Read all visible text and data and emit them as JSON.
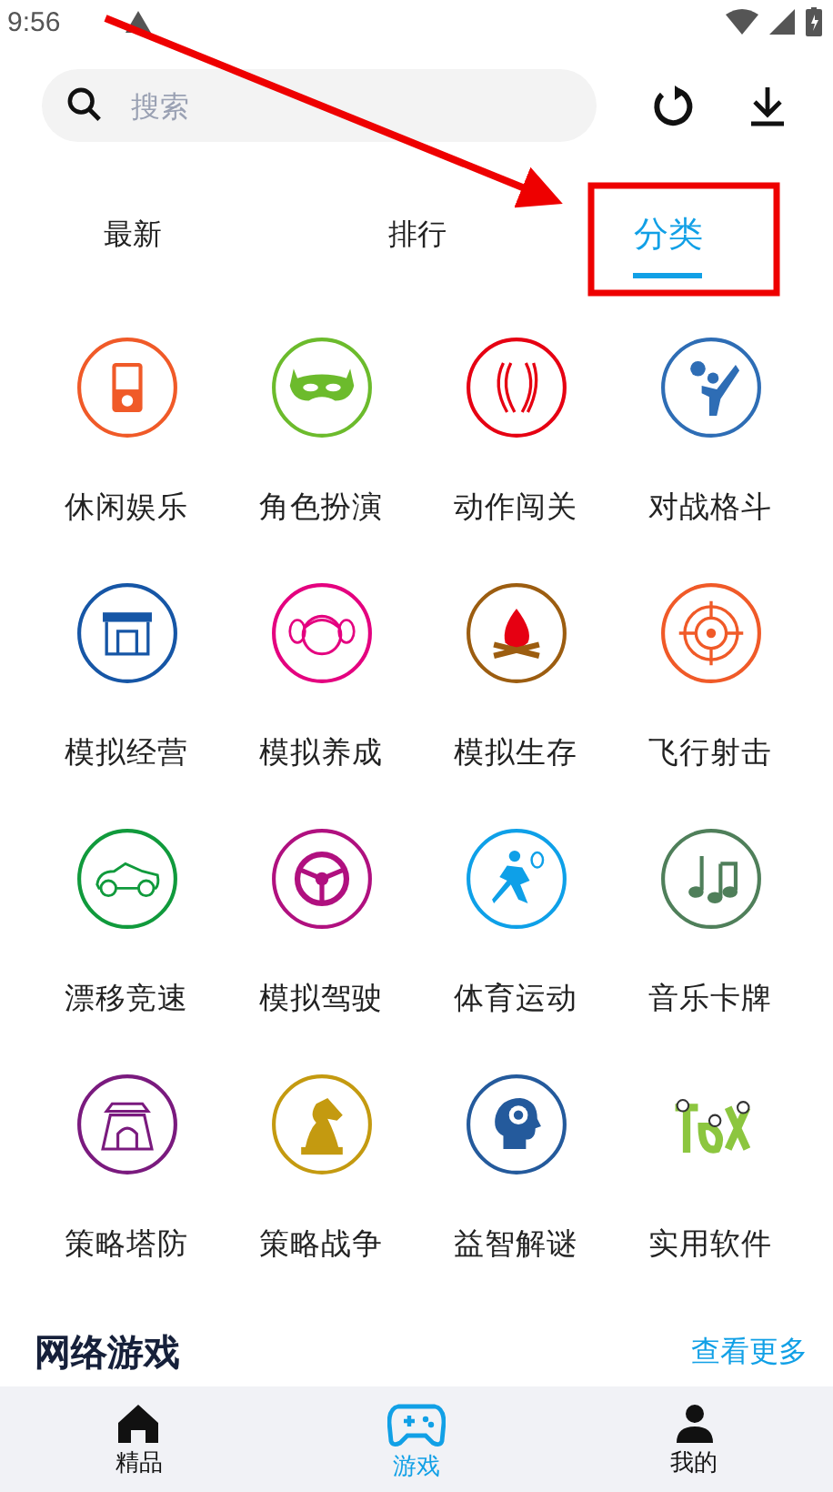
{
  "status_bar": {
    "time": "9:56"
  },
  "search": {
    "placeholder": "搜索"
  },
  "tabs": [
    {
      "label": "最新",
      "selected": false
    },
    {
      "label": "排行",
      "selected": false
    },
    {
      "label": "分类",
      "selected": true
    }
  ],
  "categories": [
    {
      "label": "休闲娱乐",
      "color": "#f05a28"
    },
    {
      "label": "角色扮演",
      "color": "#6cbb2c"
    },
    {
      "label": "动作闯关",
      "color": "#e60012"
    },
    {
      "label": "对战格斗",
      "color": "#2e6db5"
    },
    {
      "label": "模拟经营",
      "color": "#1656a6"
    },
    {
      "label": "模拟养成",
      "color": "#e4007f"
    },
    {
      "label": "模拟生存",
      "color": "#9c5d10"
    },
    {
      "label": "飞行射击",
      "color": "#f05a28"
    },
    {
      "label": "漂移竞速",
      "color": "#109a3c"
    },
    {
      "label": "模拟驾驶",
      "color": "#b0107f"
    },
    {
      "label": "体育运动",
      "color": "#0ea0e8"
    },
    {
      "label": "音乐卡牌",
      "color": "#4f7f5a"
    },
    {
      "label": "策略塔防",
      "color": "#7a1a7e"
    },
    {
      "label": "策略战争",
      "color": "#c49a10"
    },
    {
      "label": "益智解谜",
      "color": "#245a9c"
    },
    {
      "label": "实用软件",
      "color": "#8cc63f"
    }
  ],
  "section": {
    "title": "网络游戏",
    "more": "查看更多"
  },
  "bottom_nav": [
    {
      "label": "精品",
      "selected": false
    },
    {
      "label": "游戏",
      "selected": true
    },
    {
      "label": "我的",
      "selected": false
    }
  ]
}
